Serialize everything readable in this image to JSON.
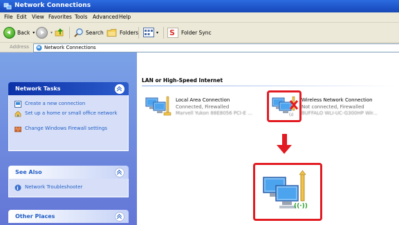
{
  "window": {
    "title": "Network Connections"
  },
  "menu": [
    "File",
    "Edit",
    "View",
    "Favorites",
    "Tools",
    "Advanced",
    "Help"
  ],
  "toolbar": {
    "back_label": "Back",
    "search_label": "Search",
    "folders_label": "Folders",
    "folder_sync_label": "Folder Sync"
  },
  "address": {
    "label": "Address",
    "value": "Network Connections"
  },
  "sidebar": {
    "network_tasks": {
      "title": "Network Tasks",
      "items": [
        "Create a new connection",
        "Set up a home or small office network",
        "Change Windows Firewall settings"
      ]
    },
    "see_also": {
      "title": "See Also",
      "items": [
        "Network Troubleshooter"
      ]
    },
    "other_places": {
      "title": "Other Places"
    }
  },
  "main": {
    "group_title": "LAN or High-Speed Internet",
    "connections": [
      {
        "name": "Local Area Connection",
        "status": "Connected, Firewalled",
        "device": "Marvell Yukon 88E8056 PCI-E ..."
      },
      {
        "name": "Wireless Network Connection",
        "status": "Not connected, Firewalled",
        "device": "BUFFALO WLI-UC-G300HP Wir..."
      }
    ],
    "wireless_badge": "((·))"
  },
  "colors": {
    "highlight": "#e21a21",
    "title_bar": "#1e55c9",
    "sidebar_bg": "#7ba2e7",
    "panel_body": "#d6dff7"
  }
}
